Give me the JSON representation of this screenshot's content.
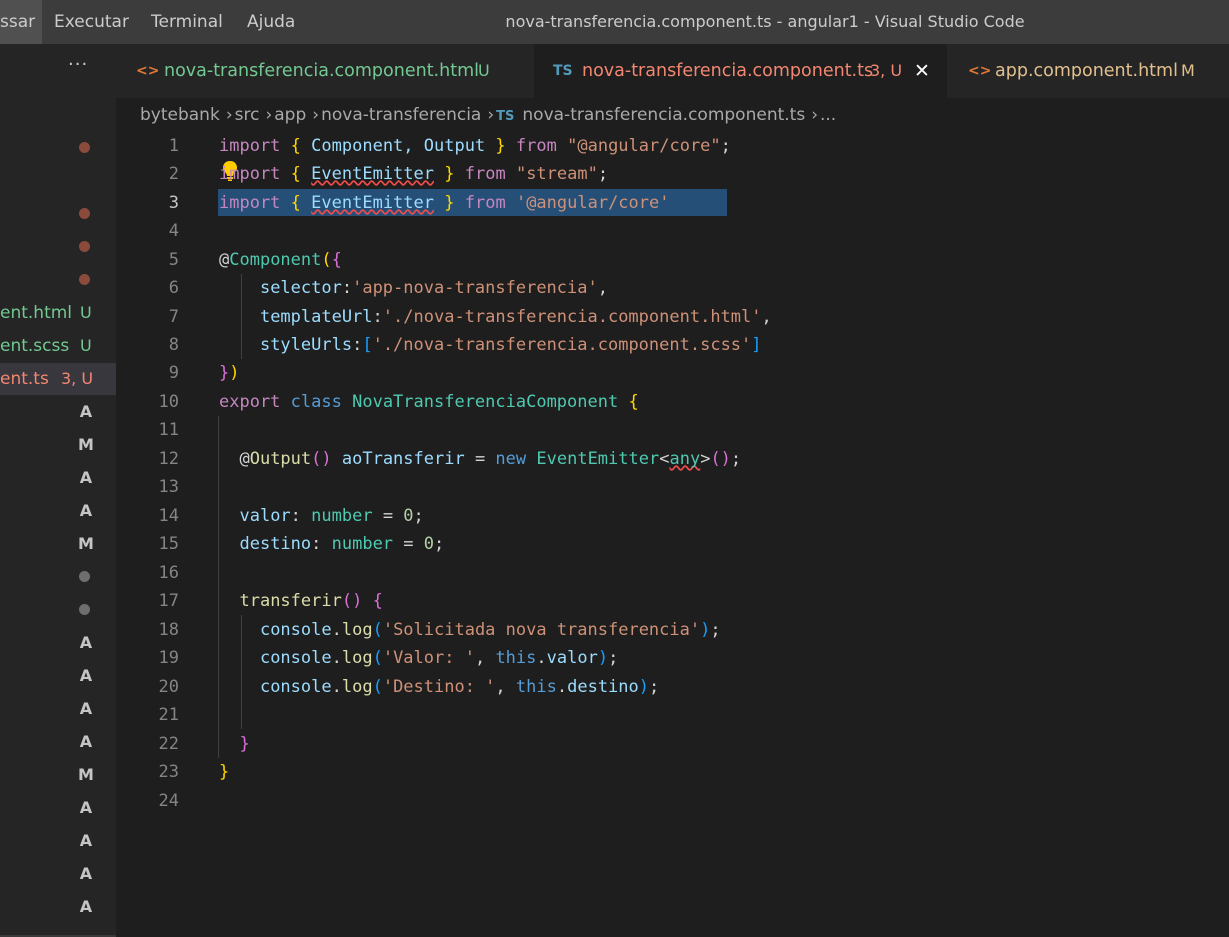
{
  "menu": [
    "ssar",
    "Executar",
    "Terminal",
    "Ajuda"
  ],
  "window_title": "nova-transferencia.component.ts - angular1 - Visual Studio Code",
  "sidebar": {
    "more": "···",
    "files": [
      {
        "name": "ent.html",
        "status": "U"
      },
      {
        "name": "ent.scss",
        "status": "U"
      },
      {
        "name": "ent.ts",
        "status": "3, U"
      }
    ],
    "status_letters": [
      "A",
      "M",
      "A",
      "A",
      "M",
      "A",
      "A",
      "A",
      "A",
      "M",
      "A",
      "A",
      "A",
      "A"
    ]
  },
  "tabs": [
    {
      "icon": "<>",
      "label": "nova-transferencia.component.html",
      "status": "U"
    },
    {
      "icon": "TS",
      "label": "nova-transferencia.component.ts",
      "status": "3, U",
      "close": "✕"
    },
    {
      "icon": "<>",
      "label": "app.component.html",
      "status": "M"
    }
  ],
  "breadcrumb": [
    "bytebank",
    "src",
    "app",
    "nova-transferencia",
    "nova-transferencia.component.ts",
    "..."
  ],
  "breadcrumb_ts_icon": "TS",
  "editor": {
    "line_numbers": [
      "1",
      "2",
      "3",
      "4",
      "5",
      "6",
      "7",
      "8",
      "9",
      "10",
      "11",
      "12",
      "13",
      "14",
      "15",
      "16",
      "17",
      "18",
      "19",
      "20",
      "21",
      "22",
      "23",
      "24"
    ],
    "code": {
      "l1_import": "import",
      "l1_names": "Component, Output",
      "l1_from": "from",
      "l1_src": "\"@angular/core\"",
      "l2_import": "import",
      "l2_names": "EventEmitter",
      "l2_from": "from",
      "l2_src": "\"stream\"",
      "l3_import": "import",
      "l3_names": "EventEmitter",
      "l3_from": "from",
      "l3_src": "'@angular/core'",
      "l5_dec": "Component",
      "l6_key": "selector",
      "l6_val": "'app-nova-transferencia'",
      "l7_key": "templateUrl",
      "l7_val": "'./nova-transferencia.component.html'",
      "l8_key": "styleUrls",
      "l8_val": "'./nova-transferencia.component.scss'",
      "l10_export": "export",
      "l10_class": "class",
      "l10_name": "NovaTransferenciaComponent",
      "l12_dec": "Output",
      "l12_prop": "aoTransferir",
      "l12_new": "new",
      "l12_cls": "EventEmitter",
      "l12_type": "any",
      "l14_prop": "valor",
      "l14_type": "number",
      "l14_num": "0",
      "l15_prop": "destino",
      "l15_type": "number",
      "l15_num": "0",
      "l17_fn": "transferir",
      "l18_obj": "console",
      "l18_fn": "log",
      "l18_str": "'Solicitada nova transferencia'",
      "l19_obj": "console",
      "l19_fn": "log",
      "l19_str": "'Valor: '",
      "l19_this": "this",
      "l19_prop": "valor",
      "l20_obj": "console",
      "l20_fn": "log",
      "l20_str": "'Destino: '",
      "l20_this": "this",
      "l20_prop": "destino"
    }
  },
  "colors": {
    "accent_modified": "#e2c08d",
    "untracked": "#73c991",
    "error_tab": "#f48771",
    "selection": "#264f78"
  }
}
